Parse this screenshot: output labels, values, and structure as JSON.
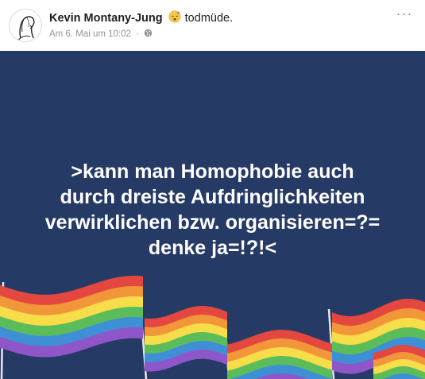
{
  "post": {
    "author": "Kevin Montany-Jung",
    "feeling_emoji": "sleepy-face-emoji",
    "feeling_text": "todmüde.",
    "timestamp": "Am 6. Mai um 10:02",
    "separator": "·",
    "privacy_icon": "globe-icon",
    "more_icon": "ellipsis-icon",
    "more_label": "···"
  },
  "image": {
    "background_color": "#263a66",
    "lines": [
      ">kann man Homophobie auch",
      "durch dreiste Aufdringlichkeiten",
      "verwirklichen bzw. organisieren=?=",
      "denke ja=!?!<"
    ],
    "decoration": "rainbow-flags",
    "flag_colors": [
      "#e4473f",
      "#f2963a",
      "#f7dd4a",
      "#5bbd5a",
      "#3f8fd6",
      "#8e56c8"
    ]
  }
}
